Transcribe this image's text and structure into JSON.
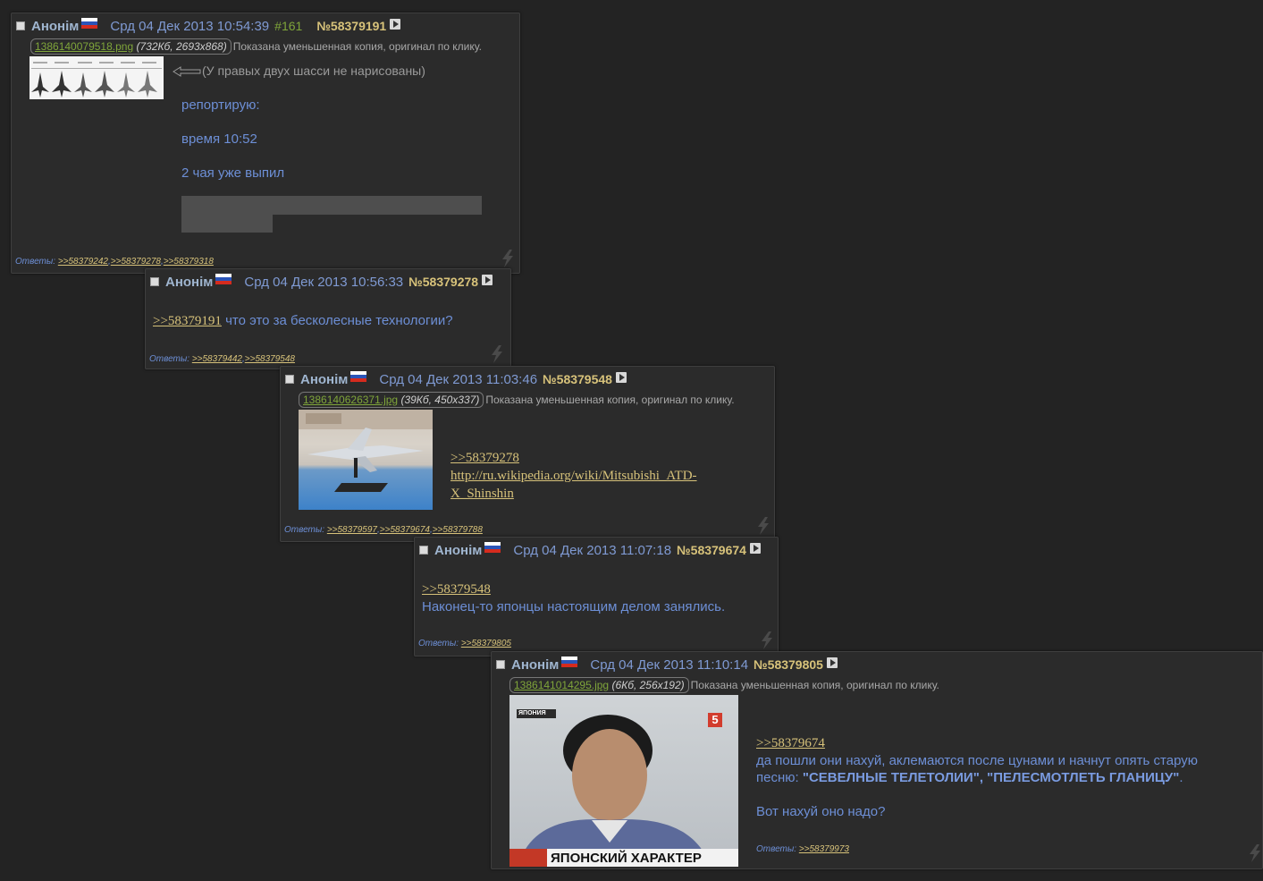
{
  "p1": {
    "name": "Анонім",
    "date": "Срд 04 Дек 2013 10:54:39",
    "count": "#161",
    "num": "№58379191",
    "file": {
      "name": "1386140079518.png",
      "meta": "(732Кб, 2693x868)"
    },
    "shown": "Показана уменьшенная копия, оригинал по клику.",
    "arrow_note": "(У правых двух шасси не нарисованы)",
    "lines": [
      "репортирую:",
      "время 10:52",
      "2 чая уже выпил"
    ],
    "replies_label": "Ответы:",
    "replies": [
      ">>58379242",
      ">>58379278",
      ">>58379318"
    ]
  },
  "p2": {
    "name": "Анонім",
    "date": "Срд 04 Дек 2013 10:56:33",
    "num": "№58379278",
    "quote": ">>58379191",
    "text": " что это за бесколесные технологии?",
    "replies_label": "Ответы:",
    "replies": [
      ">>58379442",
      ">>58379548"
    ]
  },
  "p3": {
    "name": "Анонім",
    "date": "Срд 04 Дек 2013 11:03:46",
    "num": "№58379548",
    "file": {
      "name": "1386140626371.jpg",
      "meta": "(39Кб, 450x337)"
    },
    "shown": "Показана уменьшенная копия, оригинал по клику.",
    "quote": ">>58379278",
    "link1": "http://ru.wikipedia.org/wiki/Mitsubishi_ATD-",
    "link2": "X_Shinshin",
    "replies_label": "Ответы:",
    "replies": [
      ">>58379597",
      ">>58379674",
      ">>58379788"
    ]
  },
  "p4": {
    "name": "Анонім",
    "date": "Срд 04 Дек 2013 11:07:18",
    "num": "№58379674",
    "quote": ">>58379548",
    "text": "Наконец-то японцы настоящим делом занялись.",
    "replies_label": "Ответы:",
    "replies": [
      ">>58379805"
    ]
  },
  "p5": {
    "name": "Анонім",
    "date": "Срд 04 Дек 2013 11:10:14",
    "num": "№58379805",
    "file": {
      "name": "1386141014295.jpg",
      "meta": "(6Кб, 256x192)"
    },
    "shown": "Показана уменьшенная копия, оригинал по клику.",
    "img_caption": "ЯПОНСКИЙ ХАРАКТЕР",
    "img_tag": "ЯПОНИЯ",
    "img_channel": "5",
    "quote": ">>58379674",
    "text_a": "да пошли они нахуй, аклемаются после цунами и начнут опять старую",
    "text_b": "песню: ",
    "bold": "\"СЕВЕЛНЫЕ ТЕЛЕТОЛИИ\", \"ПЕЛЕСМОТЛЕТЬ ГЛАНИЦУ\"",
    "text_c": ".",
    "text_d": "Вот нахуй оно надо?",
    "replies_label": "Ответы:",
    "replies": [
      ">>58379973"
    ]
  },
  "colors": {
    "bg": "#232323",
    "post": "#2b2b2b",
    "text": "#6d8fd6",
    "link": "#d7c27a",
    "filename": "#7fa53a"
  }
}
